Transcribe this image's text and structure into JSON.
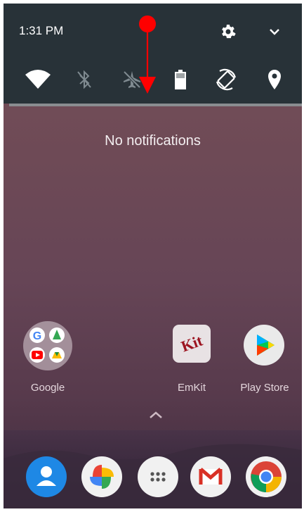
{
  "status": {
    "time": "1:31 PM"
  },
  "header_icons": [
    "settings-icon",
    "chevron-down-icon"
  ],
  "quick_settings": [
    "wifi-icon",
    "bluetooth-off-icon",
    "airplane-mode-off-icon",
    "battery-saver-icon",
    "auto-rotate-icon",
    "location-icon"
  ],
  "shade": {
    "empty_message": "No notifications"
  },
  "home_apps": [
    {
      "label": "Google"
    },
    {
      "label": "EmKit",
      "icon_text": "Kit"
    },
    {
      "label": "Play Store"
    }
  ],
  "dock": [
    "contacts-icon",
    "photos-icon",
    "app-drawer-icon",
    "gmail-icon",
    "chrome-icon"
  ],
  "annotation": {
    "color": "#ff0000",
    "gesture": "swipe-down"
  }
}
